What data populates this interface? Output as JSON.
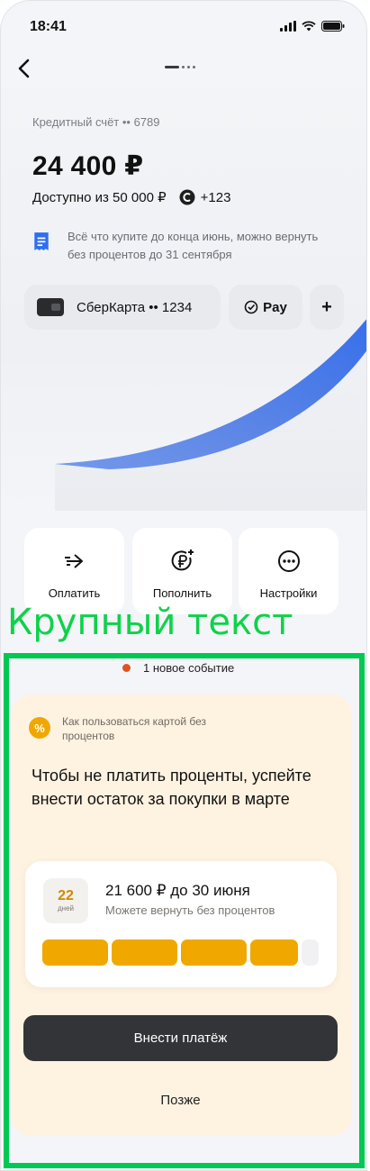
{
  "status_bar": {
    "time": "18:41"
  },
  "account": {
    "label": "Кредитный счёт •• 6789",
    "balance": "24 400 ₽",
    "available": "Доступно из 50 000 ₽",
    "bonus": "+123",
    "info": "Всё что купите до конца июнь, можно вернуть без процентов до 31 сентября"
  },
  "chips": {
    "card": "СберКарта •• 1234",
    "pay": "Pay",
    "add": "+"
  },
  "actions": [
    {
      "label": "Оплатить",
      "icon": "pay-arrow-icon"
    },
    {
      "label": "Пополнить",
      "icon": "top-up-ruble-icon"
    },
    {
      "label": "Настройки",
      "icon": "more-dots-icon"
    }
  ],
  "overlay_label": "Крупный текст",
  "events": {
    "label": "1 новое событие"
  },
  "sheet": {
    "hint": "Как пользоваться картой без процентов",
    "headline": "Чтобы не платить проценты, успейте внести остаток за покупки в марте",
    "days_num": "22",
    "days_word": "дней",
    "amount": "21 600 ₽ до 30 июня",
    "subtitle": "Можете вернуть без процентов",
    "progress_segments_filled": 4,
    "progress_segments_total": 5,
    "primary_button": "Внести платёж",
    "secondary_button": "Позже"
  },
  "colors": {
    "accent_orange": "#f0a800",
    "event_dot": "#e0531f",
    "frame_green": "#00c853",
    "label_green": "#0fd24a",
    "primary_button": "#323437",
    "hero_blue": "#1f5ee6"
  }
}
